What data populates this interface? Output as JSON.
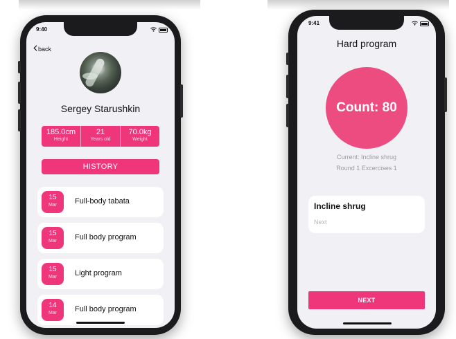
{
  "left_phone": {
    "status_time": "9:40",
    "back_label": "back",
    "profile_name": "Sergey Starushkin",
    "stats": [
      {
        "value": "185.0cm",
        "label": "Height"
      },
      {
        "value": "21",
        "label": "Years old"
      },
      {
        "value": "70.0kg",
        "label": "Weight"
      }
    ],
    "history_label": "HISTORY",
    "history": [
      {
        "day": "15",
        "month": "Mar",
        "title": "Full-body tabata"
      },
      {
        "day": "15",
        "month": "Mar",
        "title": "Full body program"
      },
      {
        "day": "15",
        "month": "Mar",
        "title": "Light program"
      },
      {
        "day": "14",
        "month": "Mar",
        "title": "Full body program"
      }
    ]
  },
  "right_phone": {
    "status_time": "9:41",
    "title": "Hard program",
    "count_label": "Count: 80",
    "current_text": "Current: Incline shrug",
    "round_text": "Round 1 Excercises 1",
    "exercise_name": "Incline shrug",
    "next_hint": "Next",
    "next_button": "NEXT"
  },
  "colors": {
    "accent": "#f0367b",
    "circle": "#ec4c7f",
    "screen_bg": "#f1f0f5",
    "frame": "#1b1b1d"
  }
}
